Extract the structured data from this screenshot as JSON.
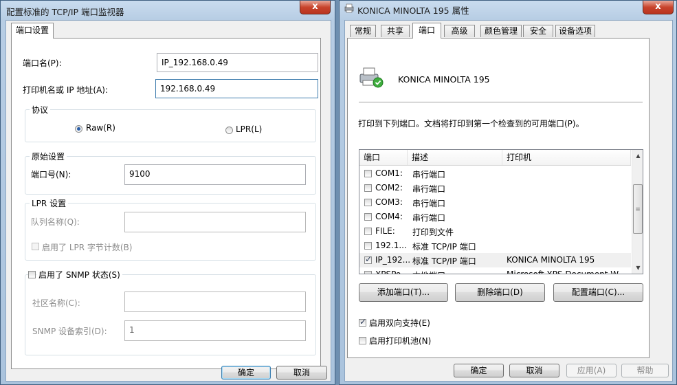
{
  "left_dialog": {
    "title": "配置标准的 TCP/IP 端口监视器",
    "close_label": "x",
    "tab": "端口设置",
    "port_name_label": "端口名(P):",
    "port_name_value": "IP_192.168.0.49",
    "host_label": "打印机名或 IP 地址(A):",
    "host_value": "192.168.0.49",
    "protocol": {
      "title": "协议",
      "raw_label": "Raw(R)",
      "lpr_label": "LPR(L)",
      "selected": "Raw"
    },
    "raw_settings": {
      "title": "原始设置",
      "port_number_label": "端口号(N):",
      "port_number_value": "9100"
    },
    "lpr_settings": {
      "title": "LPR 设置",
      "queue_label": "队列名称(Q):",
      "queue_value": "",
      "byte_count_label": "启用了 LPR 字节计数(B)"
    },
    "snmp": {
      "title": "启用了 SNMP 状态(S)",
      "community_label": "社区名称(C):",
      "community_value": "",
      "device_index_label": "SNMP 设备索引(D):",
      "device_index_value": "1"
    },
    "ok_label": "确定",
    "cancel_label": "取消"
  },
  "right_dialog": {
    "title": "KONICA MINOLTA 195 属性",
    "close_label": "x",
    "tabs": [
      "常规",
      "共享",
      "端口",
      "高级",
      "颜色管理",
      "安全",
      "设备选项"
    ],
    "active_tab": "端口",
    "printer_name": "KONICA MINOLTA 195",
    "instructions": "打印到下列端口。文档将打印到第一个检查到的可用端口(P)。",
    "columns": [
      "端口",
      "描述",
      "打印机"
    ],
    "ports": [
      {
        "port": "COM1:",
        "desc": "串行端口",
        "printer": "",
        "checked": false
      },
      {
        "port": "COM2:",
        "desc": "串行端口",
        "printer": "",
        "checked": false
      },
      {
        "port": "COM3:",
        "desc": "串行端口",
        "printer": "",
        "checked": false
      },
      {
        "port": "COM4:",
        "desc": "串行端口",
        "printer": "",
        "checked": false
      },
      {
        "port": "FILE:",
        "desc": "打印到文件",
        "printer": "",
        "checked": false
      },
      {
        "port": "192.1...",
        "desc": "标准 TCP/IP 端口",
        "printer": "",
        "checked": false
      },
      {
        "port": "IP_192...",
        "desc": "标准 TCP/IP 端口",
        "printer": "KONICA MINOLTA 195",
        "checked": true
      },
      {
        "port": "XPSPo...",
        "desc": "本地端口",
        "printer": "Microsoft XPS Document W...",
        "checked": false
      }
    ],
    "add_port_label": "添加端口(T)...",
    "delete_port_label": "删除端口(D)",
    "configure_port_label": "配置端口(C)...",
    "bidirectional_label": "启用双向支持(E)",
    "bidirectional_checked": true,
    "pooling_label": "启用打印机池(N)",
    "pooling_checked": false,
    "ok_label": "确定",
    "cancel_label": "取消",
    "apply_label": "应用(A)",
    "help_label": "帮助"
  }
}
